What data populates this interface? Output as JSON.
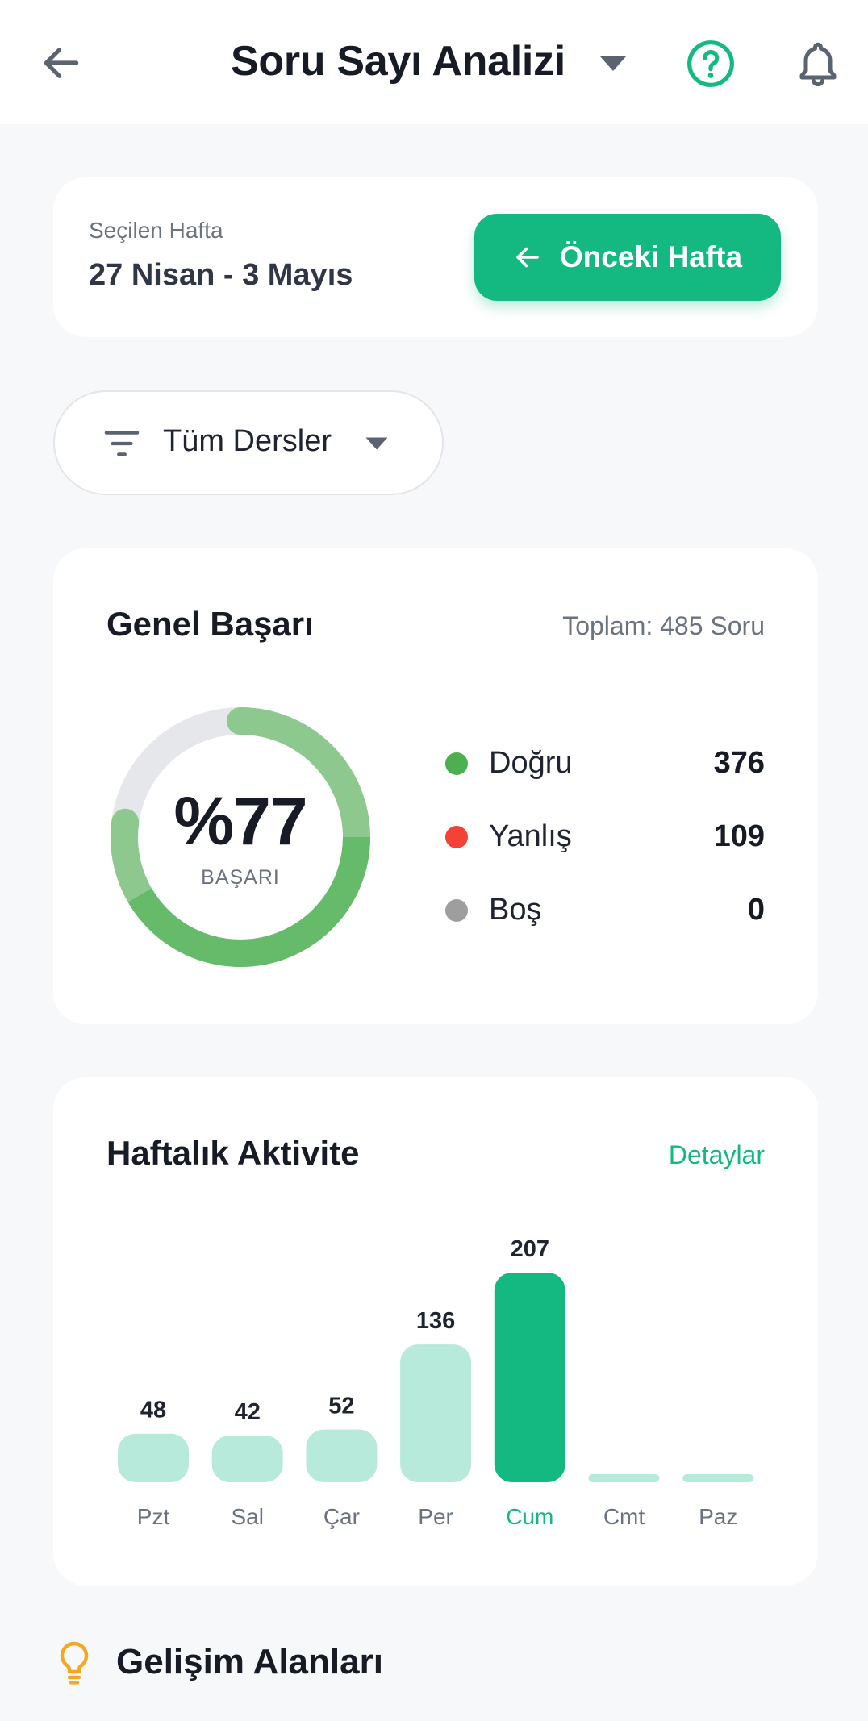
{
  "header": {
    "title": "Soru Sayı Analizi",
    "icons": {
      "back": "arrow-left-icon",
      "caret": "caret-down-icon",
      "help": "help-circle-icon",
      "notifications": "bell-icon"
    }
  },
  "week": {
    "label": "Seçilen Hafta",
    "value": "27 Nisan - 3 Mayıs",
    "prev_button": "Önceki Hafta"
  },
  "filter": {
    "selected": "Tüm Dersler",
    "icon": "filter-icon"
  },
  "stats": {
    "title": "Genel Başarı",
    "total": "Toplam: 485 Soru",
    "percent": "%77",
    "percent_value": 77,
    "percent_label": "BAŞARI",
    "legend": [
      {
        "name": "Doğru",
        "value": "376",
        "color": "#4caf50"
      },
      {
        "name": "Yanlış",
        "value": "109",
        "color": "#f44336"
      },
      {
        "name": "Boş",
        "value": "0",
        "color": "#9e9e9e"
      }
    ],
    "colors": {
      "track": "#e5e7eb",
      "arc_light": "#8dc98f",
      "arc_dark": "#66bb6a"
    }
  },
  "activity": {
    "title": "Haftalık Aktivite",
    "details_link": "Detaylar",
    "colors": {
      "bar": "#b8eadb",
      "bar_active": "#14b981",
      "label": "#6b7280",
      "label_active": "#14b981"
    }
  },
  "chart_data": {
    "type": "bar",
    "categories": [
      "Pzt",
      "Sal",
      "Çar",
      "Per",
      "Cum",
      "Cmt",
      "Paz"
    ],
    "values": [
      48,
      42,
      52,
      136,
      207,
      0,
      0
    ],
    "highlighted": "Cum",
    "title": "",
    "xlabel": "",
    "ylabel": "",
    "ylim": [
      0,
      207
    ]
  },
  "development": {
    "title": "Gelişim Alanları",
    "icon": "lightbulb-icon"
  }
}
